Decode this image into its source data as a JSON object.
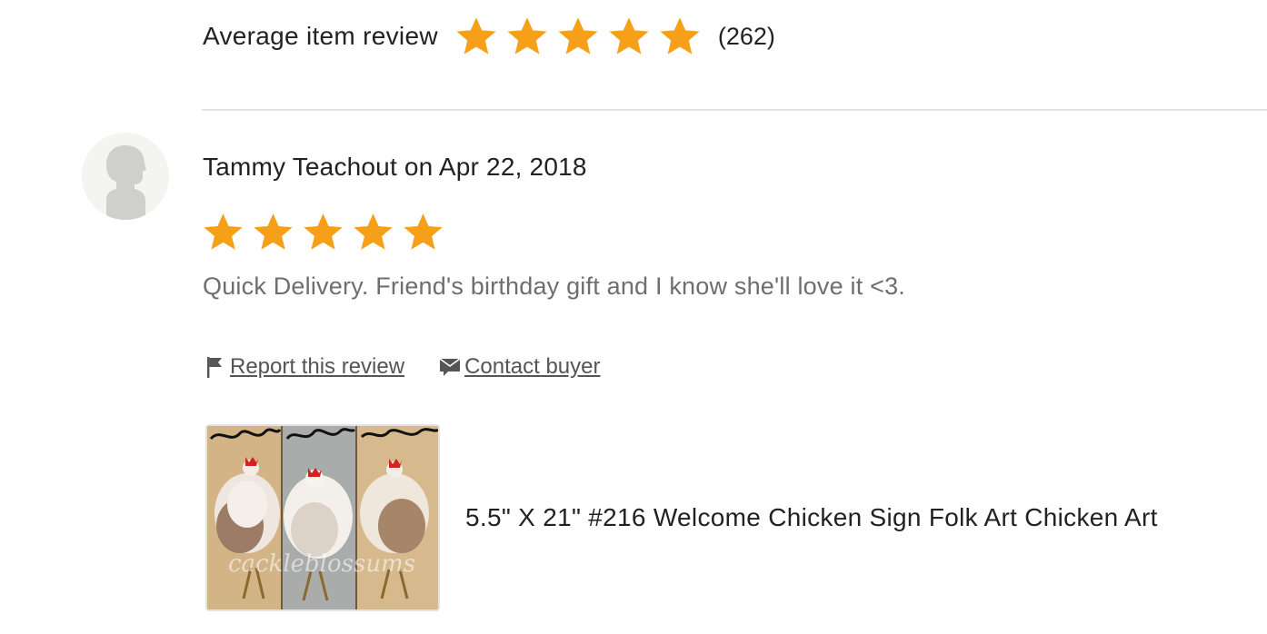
{
  "average": {
    "label": "Average item review",
    "stars": 5,
    "count": "(262)"
  },
  "review": {
    "reviewer_line": "Tammy Teachout on Apr 22, 2018",
    "stars": 5,
    "text": "Quick Delivery. Friend's birthday gift and I know she'll love it <3.",
    "actions": {
      "report_label": "Report this review",
      "contact_label": "Contact buyer"
    },
    "listing": {
      "title": "5.5\" X 21\" #216 Welcome Chicken Sign Folk Art Chicken Art",
      "watermark": "cackleblossums"
    }
  },
  "colors": {
    "star": "#f6a01a",
    "text": "#222222",
    "muted": "#6e6e6e",
    "divider": "#e1e3df"
  },
  "icons": {
    "star": "star-icon",
    "flag": "flag-icon",
    "contact": "message-icon",
    "avatar": "default-avatar-icon"
  }
}
